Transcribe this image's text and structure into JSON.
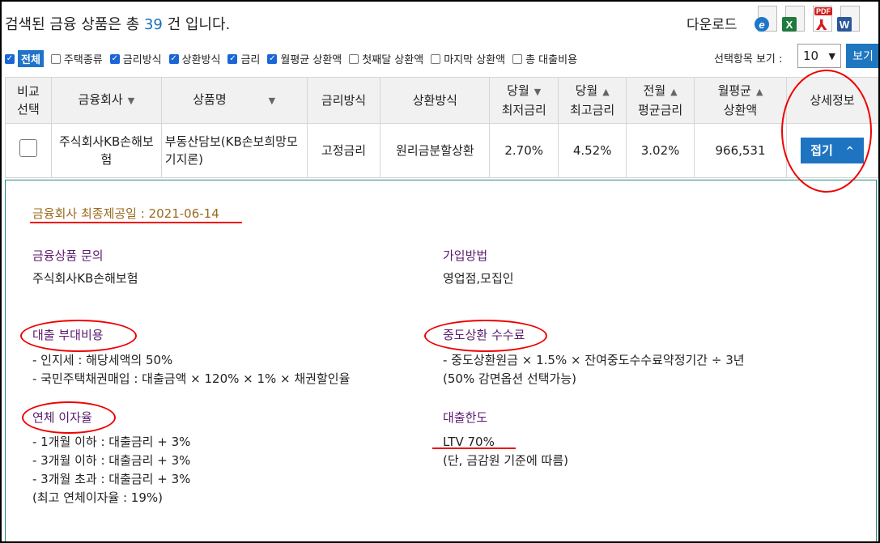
{
  "header": {
    "summary_prefix": "검색된 금융 상품은 총",
    "count": "39",
    "summary_suffix": "건 입니다.",
    "download_label": "다운로드",
    "download_icons": [
      "ie-icon",
      "excel-icon",
      "pdf-icon",
      "word-icon"
    ]
  },
  "filters": {
    "all_label": "전체",
    "items": [
      {
        "label": "주택종류",
        "checked": false
      },
      {
        "label": "금리방식",
        "checked": true
      },
      {
        "label": "상환방식",
        "checked": true
      },
      {
        "label": "금리",
        "checked": true
      },
      {
        "label": "월평균 상환액",
        "checked": true
      },
      {
        "label": "첫째달 상환액",
        "checked": false
      },
      {
        "label": "마지막 상환액",
        "checked": false
      },
      {
        "label": "총 대출비용",
        "checked": false
      }
    ],
    "view_label": "선택항목 보기 :",
    "view_value": "10",
    "view_button": "보기"
  },
  "table": {
    "headers": {
      "compare_1": "비교",
      "compare_2": "선택",
      "company": "금융회사",
      "product": "상품명",
      "rate_type": "금리방식",
      "repay_type": "상환방식",
      "min_rate_1": "당월",
      "min_rate_2": "최저금리",
      "max_rate_1": "당월",
      "max_rate_2": "최고금리",
      "avg_rate_1": "전월",
      "avg_rate_2": "평균금리",
      "monthly_1": "월평균",
      "monthly_2": "상환액",
      "detail": "상세정보"
    },
    "row": {
      "company": "주식회사KB손해보험",
      "product": "부동산담보(KB손보희망모기지론)",
      "rate_type": "고정금리",
      "repay_type": "원리금분할상환",
      "min_rate": "2.70%",
      "max_rate": "4.52%",
      "avg_rate": "3.02%",
      "monthly": "966,531",
      "fold_button": "접기"
    }
  },
  "detail": {
    "disclosure": "금융회사 최종제공일 : 2021-06-14",
    "inquiry_label": "금융상품 문의",
    "inquiry_value": "주식회사KB손해보험",
    "join_label": "가입방법",
    "join_value": "영업점,모집인",
    "cost_label": "대출 부대비용",
    "cost_line1": "- 인지세 : 해당세액의 50%",
    "cost_line2": "- 국민주택채권매입 : 대출금액 × 120% × 1% × 채권할인율",
    "fee_label": "중도상환 수수료",
    "fee_line1": "- 중도상환원금 × 1.5% × 잔여중도수수료약정기간 ÷ 3년",
    "fee_line2": "(50% 감면옵션 선택가능)",
    "overdue_label": "연체 이자율",
    "overdue_line1": "- 1개월 이하 : 대출금리 + 3%",
    "overdue_line2": "- 3개월 이하 : 대출금리 + 3%",
    "overdue_line3": "- 3개월 초과 : 대출금리 + 3%",
    "overdue_line4": "(최고 연체이자율 : 19%)",
    "limit_label": "대출한도",
    "limit_value": "LTV 70%",
    "limit_note": "(단, 금감원 기준에 따름)"
  },
  "colors": {
    "accent": "#1f74c2",
    "annotation": "#e00000",
    "label": "#5a1a6e",
    "disclosure": "#9a6a1e"
  }
}
